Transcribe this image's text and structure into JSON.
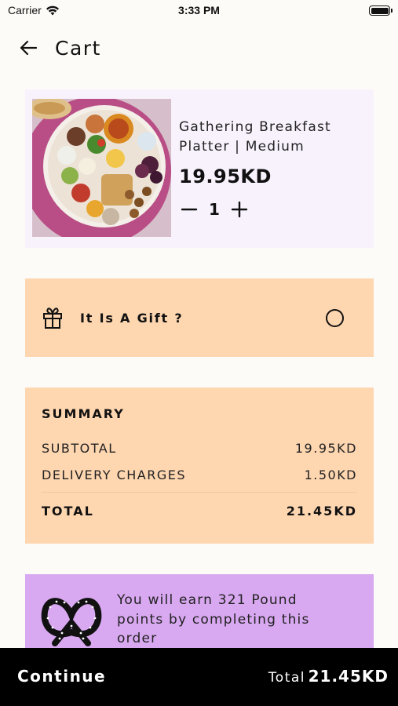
{
  "status_bar": {
    "carrier": "Carrier",
    "time": "3:33 PM"
  },
  "header": {
    "title": "Cart",
    "back_icon": "arrow-left-icon"
  },
  "cart_item": {
    "name_line1": "Gathering Breakfast",
    "name_line2": "Platter | Medium",
    "price": "19.95KD",
    "quantity": "1",
    "decrement_icon": "minus-icon",
    "increment_icon": "plus-icon"
  },
  "gift": {
    "label": "It Is A Gift ?",
    "selected": false,
    "icon": "gift-icon"
  },
  "summary": {
    "title": "SUMMARY",
    "subtotal_label": "SUBTOTAL",
    "subtotal_value": "19.95KD",
    "delivery_label": "DELIVERY CHARGES",
    "delivery_value": "1.50KD",
    "total_label": "TOTAL",
    "total_value": "21.45KD"
  },
  "points": {
    "line1": "You will earn 321 Pound",
    "line2": "points by completing this",
    "line3": "order",
    "icon": "pretzel-icon"
  },
  "footer": {
    "continue_label": "Continue",
    "total_label": "Total",
    "total_value": "21.45KD"
  },
  "colors": {
    "background": "#fdfbf7",
    "product_card": "#f8f2fd",
    "peach": "#fed6b0",
    "lavender": "#d8a8f0",
    "footer": "#000000"
  }
}
